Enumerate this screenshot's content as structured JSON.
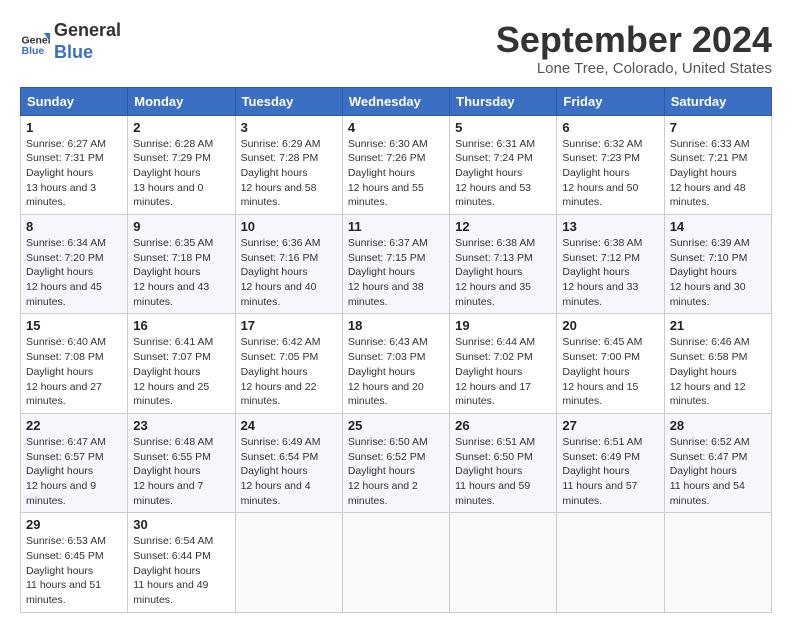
{
  "logo": {
    "line1": "General",
    "line2": "Blue"
  },
  "title": "September 2024",
  "location": "Lone Tree, Colorado, United States",
  "weekdays": [
    "Sunday",
    "Monday",
    "Tuesday",
    "Wednesday",
    "Thursday",
    "Friday",
    "Saturday"
  ],
  "weeks": [
    [
      {
        "day": "1",
        "sunrise": "6:27 AM",
        "sunset": "7:31 PM",
        "daylight": "13 hours and 3 minutes."
      },
      {
        "day": "2",
        "sunrise": "6:28 AM",
        "sunset": "7:29 PM",
        "daylight": "13 hours and 0 minutes."
      },
      {
        "day": "3",
        "sunrise": "6:29 AM",
        "sunset": "7:28 PM",
        "daylight": "12 hours and 58 minutes."
      },
      {
        "day": "4",
        "sunrise": "6:30 AM",
        "sunset": "7:26 PM",
        "daylight": "12 hours and 55 minutes."
      },
      {
        "day": "5",
        "sunrise": "6:31 AM",
        "sunset": "7:24 PM",
        "daylight": "12 hours and 53 minutes."
      },
      {
        "day": "6",
        "sunrise": "6:32 AM",
        "sunset": "7:23 PM",
        "daylight": "12 hours and 50 minutes."
      },
      {
        "day": "7",
        "sunrise": "6:33 AM",
        "sunset": "7:21 PM",
        "daylight": "12 hours and 48 minutes."
      }
    ],
    [
      {
        "day": "8",
        "sunrise": "6:34 AM",
        "sunset": "7:20 PM",
        "daylight": "12 hours and 45 minutes."
      },
      {
        "day": "9",
        "sunrise": "6:35 AM",
        "sunset": "7:18 PM",
        "daylight": "12 hours and 43 minutes."
      },
      {
        "day": "10",
        "sunrise": "6:36 AM",
        "sunset": "7:16 PM",
        "daylight": "12 hours and 40 minutes."
      },
      {
        "day": "11",
        "sunrise": "6:37 AM",
        "sunset": "7:15 PM",
        "daylight": "12 hours and 38 minutes."
      },
      {
        "day": "12",
        "sunrise": "6:38 AM",
        "sunset": "7:13 PM",
        "daylight": "12 hours and 35 minutes."
      },
      {
        "day": "13",
        "sunrise": "6:38 AM",
        "sunset": "7:12 PM",
        "daylight": "12 hours and 33 minutes."
      },
      {
        "day": "14",
        "sunrise": "6:39 AM",
        "sunset": "7:10 PM",
        "daylight": "12 hours and 30 minutes."
      }
    ],
    [
      {
        "day": "15",
        "sunrise": "6:40 AM",
        "sunset": "7:08 PM",
        "daylight": "12 hours and 27 minutes."
      },
      {
        "day": "16",
        "sunrise": "6:41 AM",
        "sunset": "7:07 PM",
        "daylight": "12 hours and 25 minutes."
      },
      {
        "day": "17",
        "sunrise": "6:42 AM",
        "sunset": "7:05 PM",
        "daylight": "12 hours and 22 minutes."
      },
      {
        "day": "18",
        "sunrise": "6:43 AM",
        "sunset": "7:03 PM",
        "daylight": "12 hours and 20 minutes."
      },
      {
        "day": "19",
        "sunrise": "6:44 AM",
        "sunset": "7:02 PM",
        "daylight": "12 hours and 17 minutes."
      },
      {
        "day": "20",
        "sunrise": "6:45 AM",
        "sunset": "7:00 PM",
        "daylight": "12 hours and 15 minutes."
      },
      {
        "day": "21",
        "sunrise": "6:46 AM",
        "sunset": "6:58 PM",
        "daylight": "12 hours and 12 minutes."
      }
    ],
    [
      {
        "day": "22",
        "sunrise": "6:47 AM",
        "sunset": "6:57 PM",
        "daylight": "12 hours and 9 minutes."
      },
      {
        "day": "23",
        "sunrise": "6:48 AM",
        "sunset": "6:55 PM",
        "daylight": "12 hours and 7 minutes."
      },
      {
        "day": "24",
        "sunrise": "6:49 AM",
        "sunset": "6:54 PM",
        "daylight": "12 hours and 4 minutes."
      },
      {
        "day": "25",
        "sunrise": "6:50 AM",
        "sunset": "6:52 PM",
        "daylight": "12 hours and 2 minutes."
      },
      {
        "day": "26",
        "sunrise": "6:51 AM",
        "sunset": "6:50 PM",
        "daylight": "11 hours and 59 minutes."
      },
      {
        "day": "27",
        "sunrise": "6:51 AM",
        "sunset": "6:49 PM",
        "daylight": "11 hours and 57 minutes."
      },
      {
        "day": "28",
        "sunrise": "6:52 AM",
        "sunset": "6:47 PM",
        "daylight": "11 hours and 54 minutes."
      }
    ],
    [
      {
        "day": "29",
        "sunrise": "6:53 AM",
        "sunset": "6:45 PM",
        "daylight": "11 hours and 51 minutes."
      },
      {
        "day": "30",
        "sunrise": "6:54 AM",
        "sunset": "6:44 PM",
        "daylight": "11 hours and 49 minutes."
      },
      null,
      null,
      null,
      null,
      null
    ]
  ]
}
